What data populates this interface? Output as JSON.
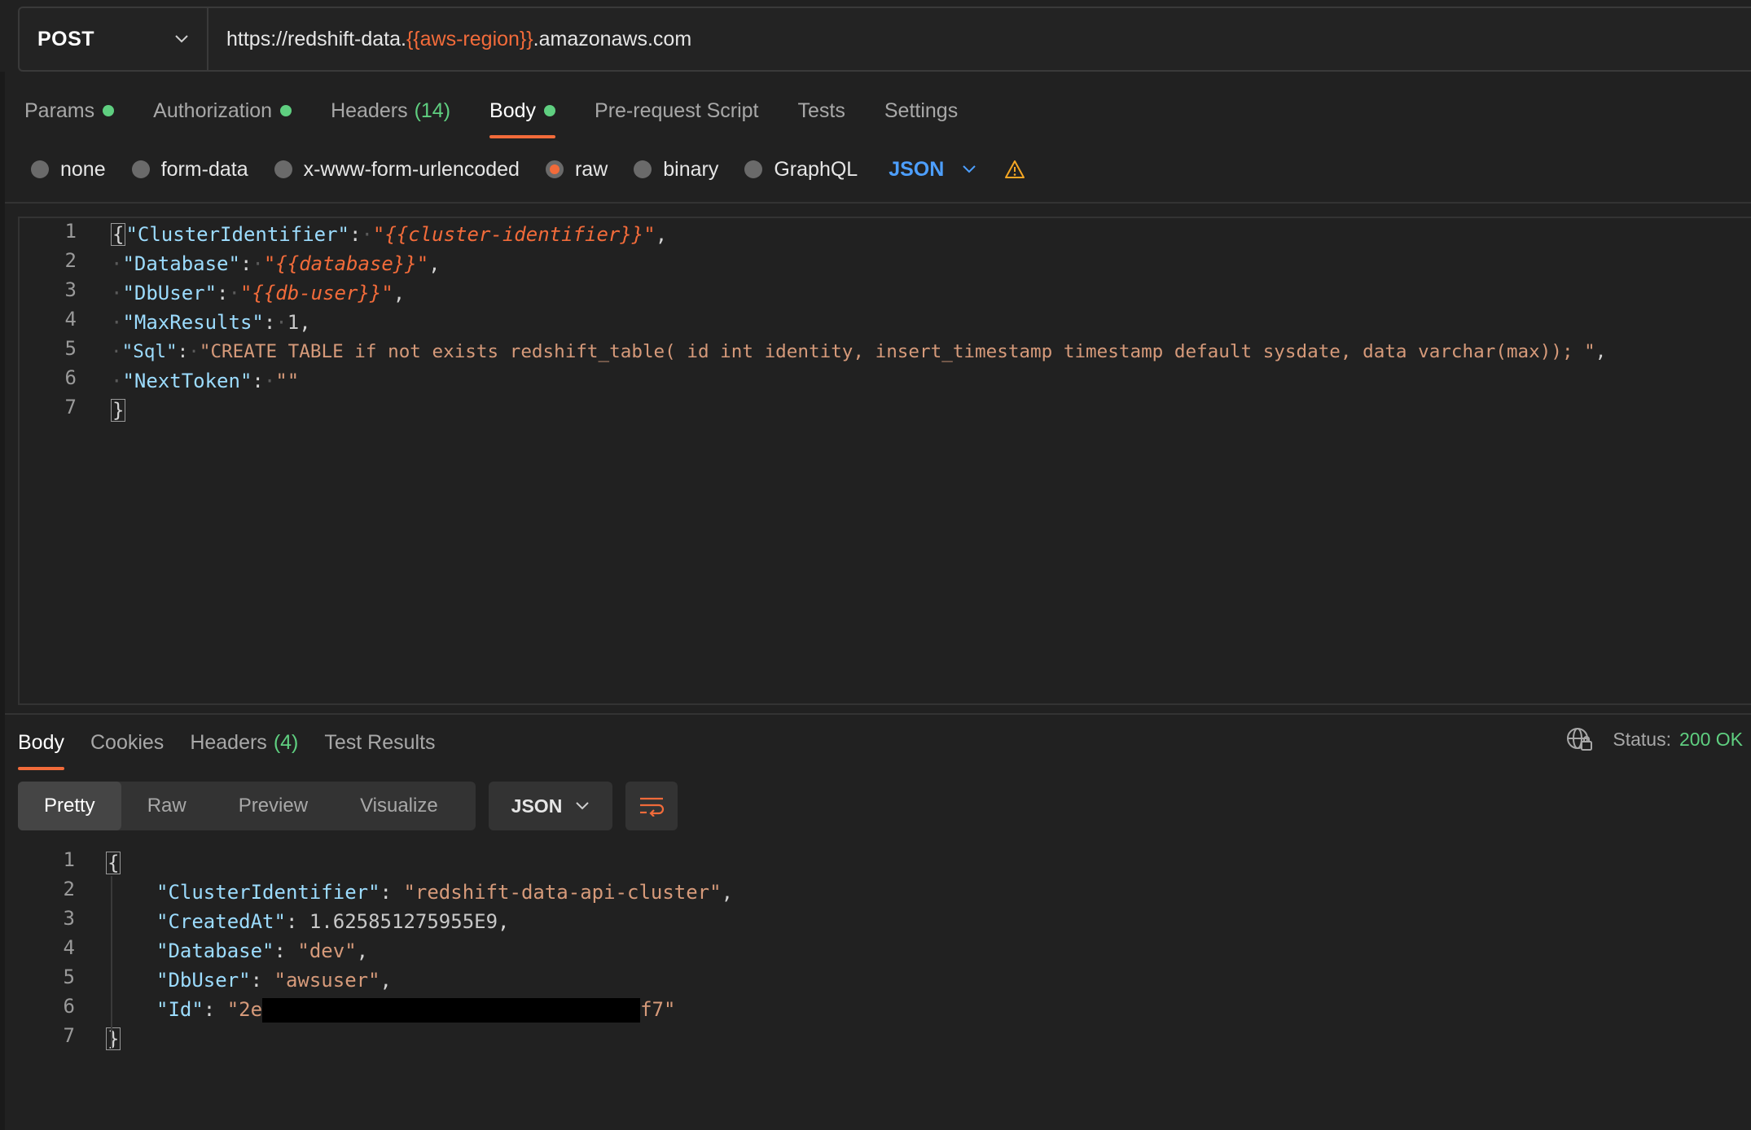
{
  "request": {
    "method": "POST",
    "url": {
      "prefix": "https://redshift-data.",
      "variable": "{{aws-region}}",
      "suffix": ".amazonaws.com"
    }
  },
  "request_tabs": [
    {
      "label": "Params",
      "dot": true
    },
    {
      "label": "Authorization",
      "dot": true
    },
    {
      "label": "Headers",
      "count": "(14)"
    },
    {
      "label": "Body",
      "dot": true,
      "active": true
    },
    {
      "label": "Pre-request Script"
    },
    {
      "label": "Tests"
    },
    {
      "label": "Settings"
    }
  ],
  "body_types": {
    "options": [
      "none",
      "form-data",
      "x-www-form-urlencoded",
      "raw",
      "binary",
      "GraphQL"
    ],
    "selected": "raw",
    "language": "JSON"
  },
  "request_body_lines": [
    {
      "n": "1",
      "key": "\"ClusterIdentifier\"",
      "value": "\"{{cluster-identifier}}\""
    },
    {
      "n": "2",
      "key": "\"Database\"",
      "value": "\"{{database}}\""
    },
    {
      "n": "3",
      "key": "\"DbUser\"",
      "value": "\"{{db-user}}\""
    },
    {
      "n": "4",
      "key": "\"MaxResults\"",
      "value": "1"
    },
    {
      "n": "5",
      "key": "\"Sql\"",
      "value": "\"CREATE TABLE if not exists redshift_table( id int identity, insert_timestamp timestamp default sysdate, data varchar(max)); \""
    },
    {
      "n": "6",
      "key": "\"NextToken\"",
      "value": "\"\""
    },
    {
      "n": "7"
    }
  ],
  "response_tabs": [
    {
      "label": "Body",
      "active": true
    },
    {
      "label": "Cookies"
    },
    {
      "label": "Headers",
      "count": "(4)"
    },
    {
      "label": "Test Results"
    }
  ],
  "status": {
    "label": "Status:",
    "value": "200 OK"
  },
  "view_modes": [
    "Pretty",
    "Raw",
    "Preview",
    "Visualize"
  ],
  "view_selected": "Pretty",
  "response_format": "JSON",
  "response_body_lines": [
    {
      "n": "1"
    },
    {
      "n": "2",
      "key": "\"ClusterIdentifier\"",
      "value": "\"redshift-data-api-cluster\""
    },
    {
      "n": "3",
      "key": "\"CreatedAt\"",
      "value": "1.625851275955E9"
    },
    {
      "n": "4",
      "key": "\"Database\"",
      "value": "\"dev\""
    },
    {
      "n": "5",
      "key": "\"DbUser\"",
      "value": "\"awsuser\""
    },
    {
      "n": "6",
      "key": "\"Id\"",
      "value_start": "\"2e",
      "value_end": "f7\""
    },
    {
      "n": "7"
    }
  ],
  "colors": {
    "accent": "#f26b3a",
    "success": "#5fcf80",
    "link": "#4d9fff",
    "warning": "#f5a623"
  }
}
